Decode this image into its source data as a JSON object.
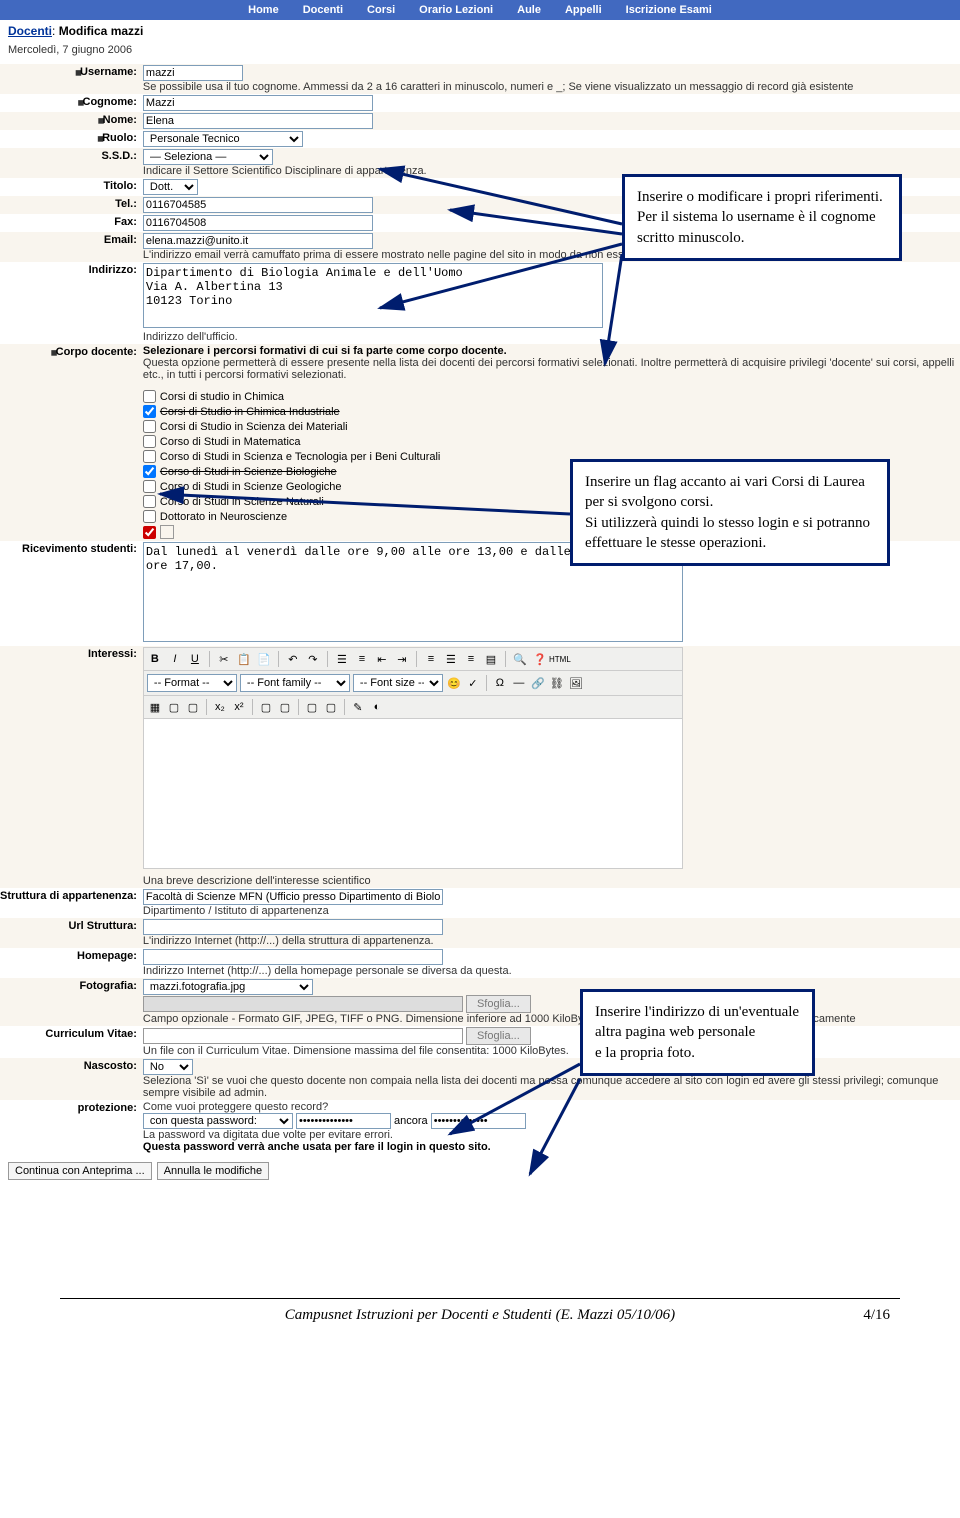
{
  "nav": [
    "Home",
    "Docenti",
    "Corsi",
    "Orario Lezioni",
    "Aule",
    "Appelli",
    "Iscrizione Esami"
  ],
  "breadcrumb": {
    "link": "Docenti",
    "page": "Modifica mazzi"
  },
  "date": "Mercoledì, 7 giugno 2006",
  "labels": {
    "username": "Username:",
    "cognome": "Cognome:",
    "nome": "Nome:",
    "ruolo": "Ruolo:",
    "ssd": "S.S.D.:",
    "titolo": "Titolo:",
    "tel": "Tel.:",
    "fax": "Fax:",
    "email": "Email:",
    "indirizzo": "Indirizzo:",
    "corpo": "Corpo docente:",
    "ricevimento": "Ricevimento studenti:",
    "interessi": "Interessi:",
    "struttura": "Struttura di appartenenza:",
    "url_struttura": "Url Struttura:",
    "homepage": "Homepage:",
    "fotografia": "Fotografia:",
    "cv": "Curriculum Vitae:",
    "nascosto": "Nascosto:",
    "protezione": "protezione:"
  },
  "values": {
    "username": "mazzi",
    "cognome": "Mazzi",
    "nome": "Elena",
    "ruolo": "Personale Tecnico",
    "ssd": "— Seleziona —",
    "titolo": "Dott.",
    "tel": "0116704585",
    "fax": "0116704508",
    "email": "elena.mazzi@unito.it",
    "indirizzo": "Dipartimento di Biologia Animale e dell'Uomo\nVia A. Albertina 13\n10123 Torino",
    "ricevimento": "Dal lunedì al venerdì dalle ore 9,00 alle ore 13,00 e dalle ore 14,00 alle ore 17,00.",
    "struttura": "Facoltà di Scienze MFN (Ufficio presso Dipartimento di Biologia A",
    "url_struttura": "",
    "homepage": "",
    "fotografia": "mazzi.fotografia.jpg",
    "nascosto": "No",
    "prot_select": "con questa password:",
    "prot_pw": "**************",
    "prot_again": "ancora",
    "prot_pw2": "**************"
  },
  "hints": {
    "username": "Se possibile usa il tuo cognome. Ammessi da 2 a 16 caratteri in minuscolo, numeri e _; Se viene visualizzato un messaggio di record già esistente",
    "ssd": "Indicare il Settore Scientifico Disciplinare di appartenenza.",
    "email": "L'indirizzo email verrà camuffato prima di essere mostrato nelle pagine del sito in modo da non essere catturato dai robot per azioni di spam.",
    "indirizzo": "Indirizzo dell'ufficio.",
    "corpo_bold": "Selezionare i percorsi formativi di cui si fa parte come corpo docente.",
    "corpo": "Questa opzione permetterà di essere presente nella lista dei docenti dei percorsi formativi selezionati. Inoltre permetterà di acquisire privilegi 'docente' sui corsi, appelli etc., in tutti i percorsi formativi selezionati.",
    "interessi": "Una breve descrizione dell'interesse scientifico",
    "struttura": "Dipartimento / Istituto di appartenenza",
    "url_struttura": "L'indirizzo Internet (http://...) della struttura di appartenenza.",
    "homepage": "Indirizzo Internet (http://...) della homepage personale se diversa da questa.",
    "fotografia": "Campo opzionale - Formato GIF, JPEG, TIFF o PNG. Dimensione inferiore ad 1000 KiloBytes. La fotografia verrà ridimensionata automaticamente",
    "cv": "Un file con il Curriculum Vitae. Dimensione massima del file consentita: 1000 KiloBytes.",
    "nascosto": "Seleziona 'Sì' se vuoi che questo docente non compaia nella lista dei docenti ma possa comunque accedere al sito con login ed avere gli stessi privilegi; comunque sempre visibile ad admin.",
    "protezione": "Come vuoi proteggere questo record?",
    "protezione2": "La password va digitata due volte per evitare errori.",
    "protezione3": "Questa password verrà anche usata per fare il login in questo sito."
  },
  "courses": [
    {
      "label": "Corsi di studio in Chimica",
      "checked": false,
      "strike": false
    },
    {
      "label": "Corsi di Studio in Chimica Industriale",
      "checked": true,
      "strike": true
    },
    {
      "label": "Corsi di Studio in Scienza dei Materiali",
      "checked": false,
      "strike": false
    },
    {
      "label": "Corso di Studi in Matematica",
      "checked": false,
      "strike": false
    },
    {
      "label": "Corso di Studi in Scienza e Tecnologia per i Beni Culturali",
      "checked": false,
      "strike": false
    },
    {
      "label": "Corso di Studi in Scienze Biologiche",
      "checked": true,
      "strike": true
    },
    {
      "label": "Corso di Studi in Scienze Geologiche",
      "checked": false,
      "strike": false
    },
    {
      "label": "Corso di Studi in Scienze Naturali",
      "checked": false,
      "strike": false
    },
    {
      "label": "Dottorato in Neuroscienze",
      "checked": false,
      "strike": false
    }
  ],
  "editor": {
    "format": "-- Format --",
    "font_family": "-- Font family --",
    "font_size": "-- Font size --",
    "html": "HTML"
  },
  "buttons": {
    "sfoglia": "Sfoglia...",
    "continua": "Continua con Anteprima ...",
    "annulla": "Annulla le modifiche"
  },
  "callouts": {
    "c1": "Inserire o modificare i propri riferimenti. Per il sistema lo username è il cognome scritto minuscolo.",
    "c2": "Inserire un flag accanto ai vari Corsi di Laurea per si svolgono corsi.\nSi utilizzerà quindi lo stesso login e si potranno effettuare le stesse operazioni.",
    "c3": "Inserire l'indirizzo di un'eventuale altra pagina web personale\ne la propria foto."
  },
  "footer": {
    "text": "Campusnet Istruzioni per Docenti e Studenti (E. Mazzi 05/10/06)",
    "page": "4/16"
  }
}
